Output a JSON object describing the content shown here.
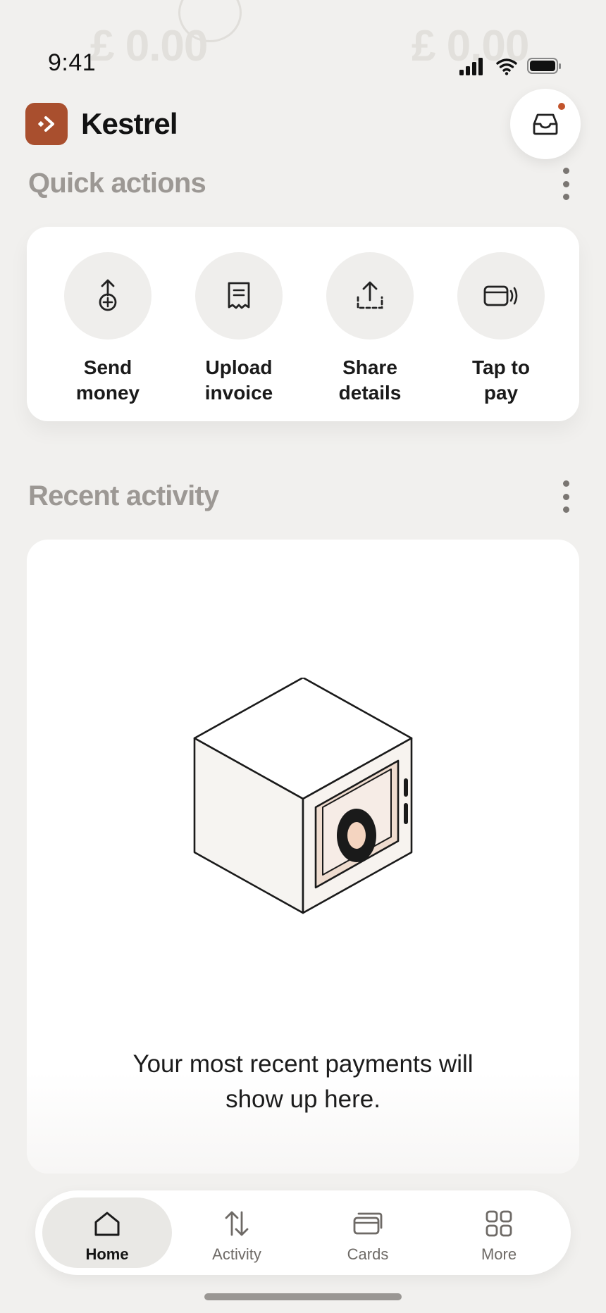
{
  "background": {
    "ghost_amount_left": "£ 0.00",
    "ghost_amount_right": "£ 0.00"
  },
  "status_bar": {
    "time": "9:41",
    "signal_icon": "cellular-signal-icon",
    "wifi_icon": "wifi-icon",
    "battery_icon": "battery-icon"
  },
  "header": {
    "brand_name": "Kestrel",
    "brand_color": "#A94F2E",
    "inbox_icon": "inbox-icon",
    "notification_dot_color": "#C2542C"
  },
  "quick_actions": {
    "title": "Quick actions",
    "items": [
      {
        "label": "Send\nmoney",
        "icon": "send-money-icon"
      },
      {
        "label": "Upload\ninvoice",
        "icon": "receipt-icon"
      },
      {
        "label": "Share\ndetails",
        "icon": "share-icon"
      },
      {
        "label": "Tap to\npay",
        "icon": "contactless-card-icon"
      }
    ]
  },
  "recent_activity": {
    "title": "Recent activity",
    "illustration": "safe-illustration",
    "empty_message": "Your most recent payments will\nshow up here."
  },
  "tab_bar": {
    "tabs": [
      {
        "label": "Home",
        "icon": "home-icon",
        "active": true
      },
      {
        "label": "Activity",
        "icon": "arrows-up-down-icon",
        "active": false
      },
      {
        "label": "Cards",
        "icon": "cards-icon",
        "active": false
      },
      {
        "label": "More",
        "icon": "grid-icon",
        "active": false
      }
    ]
  }
}
